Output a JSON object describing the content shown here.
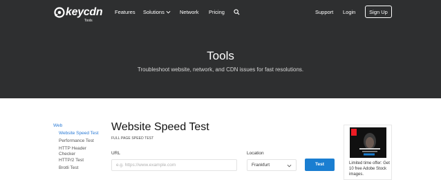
{
  "brand": {
    "name": "keycdn",
    "sub": "Tools"
  },
  "nav": {
    "features": "Features",
    "solutions": "Solutions",
    "network": "Network",
    "pricing": "Pricing",
    "support": "Support",
    "login": "Login",
    "signup": "Sign Up"
  },
  "hero": {
    "title": "Tools",
    "subtitle": "Troubleshoot website, network, and CDN issues for fast resolutions."
  },
  "sidebar": {
    "section": "Web",
    "items": [
      {
        "label": "Website Speed Test"
      },
      {
        "label": "Performance Test"
      },
      {
        "label": "HTTP Header Checker"
      },
      {
        "label": "HTTP/2 Test"
      },
      {
        "label": "Brotli Test"
      }
    ]
  },
  "main": {
    "title": "Website Speed Test",
    "subtitle": "FULL PAGE SPEED TEST",
    "url_label": "URL",
    "url_placeholder": "e.g. https://www.example.com",
    "location_label": "Location",
    "location_value": "Frankfurt",
    "test_button": "Test"
  },
  "ad": {
    "text": "Limited time offer: Get 10 free Adobe Stock images."
  },
  "colors": {
    "header_bg": "#2e2f30",
    "accent": "#1a7ed1",
    "link": "#2a7ad5"
  }
}
